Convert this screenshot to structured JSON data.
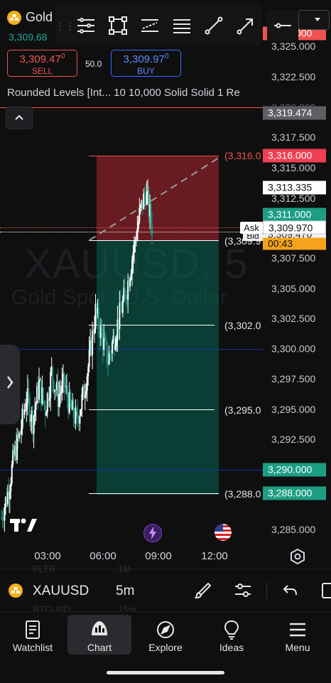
{
  "symbol": {
    "short_name": "Gold",
    "price": "3,309.68",
    "code": "XAUUSD",
    "timeframe": "5m",
    "watermark_symbol": "XAUUSD, 5",
    "watermark_description": "Gold Spot / U.S. Dollar"
  },
  "trade": {
    "sell_price": "3,309.47",
    "sell_superscript": "0",
    "sell_label": "SELL",
    "spread": "50.0",
    "buy_price": "3,309.97",
    "buy_superscript": "0",
    "buy_label": "BUY"
  },
  "indicator_legend": "Rounded Levels [Int... 10 10,000 Solid Solid 1 Re",
  "price_ticks": [
    "3,325.000",
    "3,322.500",
    "3,320.000",
    "3,317.500",
    "3,315.000",
    "3,312.500",
    "3,307.500",
    "3,305.000",
    "3,302.500",
    "3,297.500",
    "3,295.000",
    "3,292.500",
    "3,285.000"
  ],
  "price_labels": {
    "top_clipped": "3,326.000",
    "red_line": "3,319.474",
    "stop": "3,316.000",
    "last": "3,313.335",
    "target1": "3,311.000",
    "ask_tag": "Ask",
    "bid_tag": "Bid",
    "ask": "3,309.970",
    "bid": "3,309.470",
    "countdown": "00:43",
    "blue_line": "3,300.000",
    "level_3290": "3,290.000",
    "level_3288": "3,288.000"
  },
  "level_labels": {
    "stop": "(3,316.0",
    "entry": "(3,309.9",
    "l3302": "(3,302.0",
    "l3295": "(3,295.0",
    "l3288": "(3,288.0"
  },
  "time_axis": [
    "03:00",
    "06:00",
    "09:00",
    "12:00"
  ],
  "bottom_ghost": [
    "PLTR",
    "1M",
    "BTCUSD",
    "15m"
  ],
  "nav": [
    {
      "label": "Watchlist",
      "icon": "watchlist-icon"
    },
    {
      "label": "Chart",
      "icon": "chart-icon"
    },
    {
      "label": "Explore",
      "icon": "compass-icon"
    },
    {
      "label": "Ideas",
      "icon": "lightbulb-icon"
    },
    {
      "label": "Menu",
      "icon": "hamburger-icon"
    }
  ],
  "colors": {
    "up": "#26a69a",
    "down": "#ef5350",
    "buy": "#3d6bff",
    "countdown": "#f7a21b",
    "blue_level": "#1b2ea8"
  },
  "chart_data": {
    "type": "candlestick",
    "symbol": "XAUUSD",
    "interval": "5m",
    "ylim": [
      3283.5,
      3326.5
    ],
    "x_ticks": [
      "03:00",
      "06:00",
      "09:00",
      "12:00"
    ],
    "approx_close_path": [
      3286,
      3288,
      3291,
      3293,
      3296,
      3294,
      3297,
      3295,
      3298,
      3296,
      3297,
      3295,
      3294,
      3296,
      3299,
      3303,
      3301,
      3299,
      3301,
      3303,
      3305,
      3308,
      3311,
      3313,
      3310
    ],
    "horizontal_levels": [
      3319.474,
      3316.0,
      3311.0,
      3309.97,
      3309.47,
      3302.0,
      3300.0,
      3295.0,
      3290.0,
      3288.0
    ],
    "position_tool": {
      "entry": 3309.97,
      "stop": 3316.0,
      "target": 3288.0
    }
  }
}
